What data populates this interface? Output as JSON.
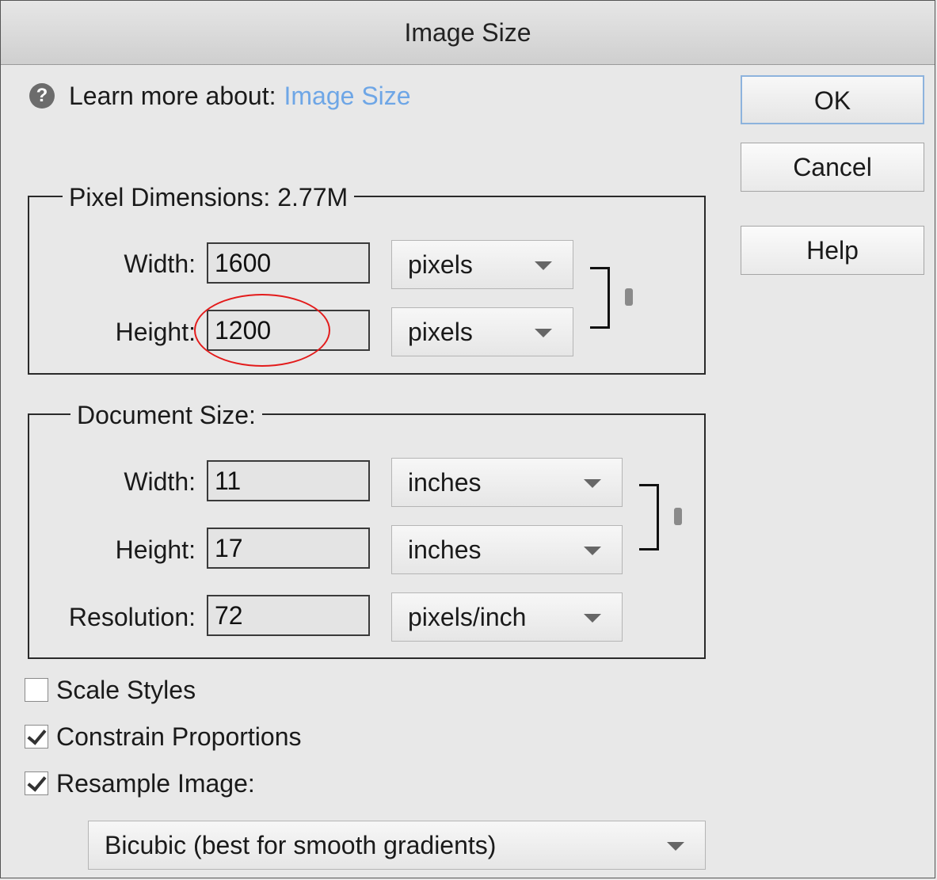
{
  "window": {
    "title": "Image Size"
  },
  "help": {
    "prefix": "Learn more about:",
    "link": "Image Size"
  },
  "buttons": {
    "ok": "OK",
    "cancel": "Cancel",
    "help": "Help"
  },
  "pixel_dimensions": {
    "legend": "Pixel Dimensions:  2.77M",
    "width_label": "Width:",
    "width_value": "1600",
    "width_unit": "pixels",
    "height_label": "Height:",
    "height_value": "1200",
    "height_unit": "pixels"
  },
  "document_size": {
    "legend": "Document Size:",
    "width_label": "Width:",
    "width_value": "11",
    "width_unit": "inches",
    "height_label": "Height:",
    "height_value": "17",
    "height_unit": "inches",
    "resolution_label": "Resolution:",
    "resolution_value": "72",
    "resolution_unit": "pixels/inch"
  },
  "options": {
    "scale_styles": {
      "label": "Scale Styles",
      "checked": false
    },
    "constrain_proportions": {
      "label": "Constrain Proportions",
      "checked": true
    },
    "resample_image": {
      "label": "Resample Image:",
      "checked": true
    }
  },
  "resample_method": "Bicubic (best for smooth gradients)",
  "colors": {
    "link": "#6ea6e6",
    "annotation": "#e31b1b",
    "ok_border": "#8db3dd"
  },
  "icons": {
    "help": "question-circle-icon",
    "chain": "chain-link-icon",
    "dropdown": "chevron-down-icon",
    "check": "checkmark-icon"
  }
}
